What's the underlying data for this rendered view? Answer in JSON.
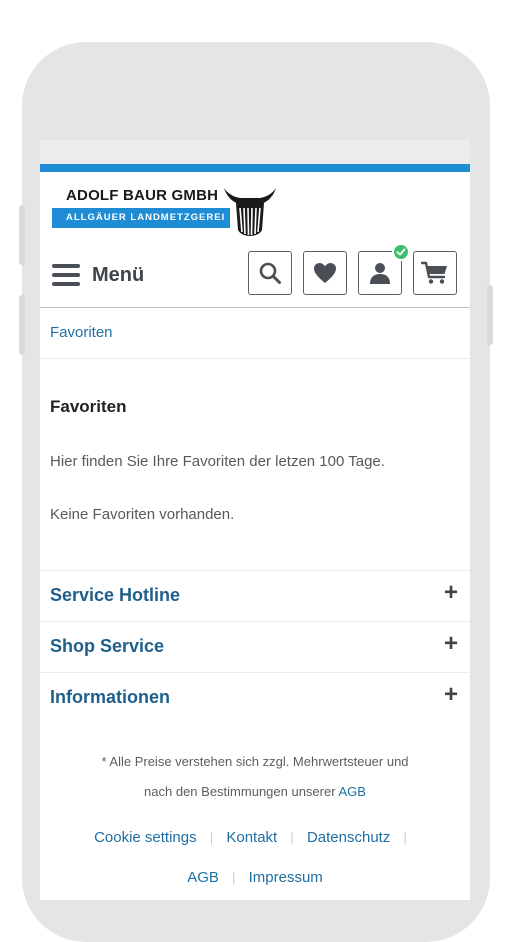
{
  "header": {
    "logo": {
      "company": "ADOLF BAUR GMBH",
      "tagline": "ALLGÄUER LANDMETZGEREI"
    },
    "menu_label": "Menü",
    "icons": [
      "search-icon",
      "heart-icon",
      "user-icon",
      "cart-icon"
    ],
    "account_badge": "check-icon"
  },
  "breadcrumb": "Favoriten",
  "main": {
    "title": "Favoriten",
    "intro": "Hier finden Sie Ihre Favoriten der letzen 100 Tage.",
    "empty_message": "Keine Favoriten vorhanden."
  },
  "accordion": [
    {
      "label": "Service Hotline",
      "toggle": "+"
    },
    {
      "label": "Shop Service",
      "toggle": "+"
    },
    {
      "label": "Informationen",
      "toggle": "+"
    }
  ],
  "footer": {
    "price_note_line1": "* Alle Preise verstehen sich zzgl. Mehrwertsteuer und",
    "price_note_line2": "nach den Bestimmungen unserer",
    "price_note_link": "AGB",
    "links_row1": [
      "Cookie settings",
      "Kontakt",
      "Datenschutz"
    ],
    "links_row2": [
      "AGB",
      "Impressum"
    ],
    "separator": "|"
  },
  "colors": {
    "brand_blue": "#1f8dd6",
    "link_blue": "#1f6fa3",
    "heading_blue": "#1f5f8c",
    "badge_green": "#3cbf6a"
  }
}
